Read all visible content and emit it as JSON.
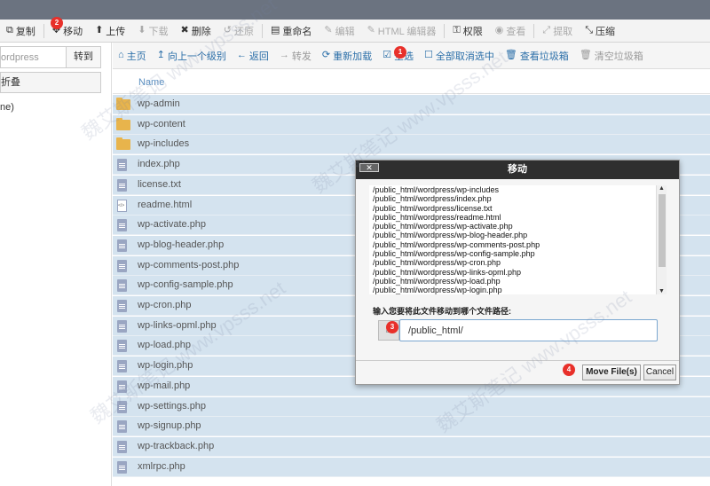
{
  "toolbar": {
    "items": [
      {
        "icon": "copy-icon",
        "glyph": "⧉",
        "label": "复制",
        "disabled": false
      },
      {
        "icon": "move-icon",
        "glyph": "✥",
        "label": "移动",
        "disabled": false
      },
      {
        "icon": "upload-icon",
        "glyph": "⬆",
        "label": "上传",
        "disabled": false
      },
      {
        "icon": "download-icon",
        "glyph": "⬇",
        "label": "下载",
        "disabled": true
      },
      {
        "icon": "delete-icon",
        "glyph": "✖",
        "label": "删除",
        "disabled": false
      },
      {
        "icon": "restore-icon",
        "glyph": "↺",
        "label": "还原",
        "disabled": true
      },
      {
        "icon": "rename-icon",
        "glyph": "▤",
        "label": "重命名",
        "disabled": false
      },
      {
        "icon": "edit-icon",
        "glyph": "✎",
        "label": "编辑",
        "disabled": true
      },
      {
        "icon": "html-editor-icon",
        "glyph": "✎",
        "label": "HTML 编辑器",
        "disabled": true
      },
      {
        "icon": "key-icon",
        "glyph": "⚿",
        "label": "权限",
        "disabled": false
      },
      {
        "icon": "eye-icon",
        "glyph": "◉",
        "label": "查看",
        "disabled": true
      },
      {
        "icon": "extract-icon",
        "glyph": "⤢",
        "label": "提取",
        "disabled": true
      },
      {
        "icon": "compress-icon",
        "glyph": "⤡",
        "label": "压缩",
        "disabled": false
      }
    ]
  },
  "sidebar": {
    "search_value": "ordpress",
    "go_label": "转到",
    "collapse_label": "折叠",
    "tree_item": "ne)"
  },
  "nav": {
    "items": [
      {
        "icon": "home-icon",
        "glyph": "⌂",
        "label": "主页",
        "disabled": false
      },
      {
        "icon": "level-up-icon",
        "glyph": "↥",
        "label": "向上一个级别",
        "disabled": false
      },
      {
        "icon": "back-icon",
        "glyph": "←",
        "label": "返回",
        "disabled": false
      },
      {
        "icon": "forward-icon",
        "glyph": "→",
        "label": "转发",
        "disabled": true
      },
      {
        "icon": "reload-icon",
        "glyph": "⟳",
        "label": "重新加载",
        "disabled": false
      },
      {
        "icon": "select-all-icon",
        "glyph": "☑",
        "label": "全选",
        "disabled": false
      },
      {
        "icon": "deselect-icon",
        "glyph": "☐",
        "label": "全部取消选中",
        "disabled": false
      },
      {
        "icon": "trash-icon",
        "glyph": "🗑",
        "label": "查看垃圾箱",
        "disabled": false
      },
      {
        "icon": "empty-trash-icon",
        "glyph": "🗑",
        "label": "清空垃圾箱",
        "disabled": true
      }
    ]
  },
  "file_header": {
    "name_label": "Name"
  },
  "files": [
    {
      "name": "wp-admin",
      "type": "folder"
    },
    {
      "name": "wp-content",
      "type": "folder"
    },
    {
      "name": "wp-includes",
      "type": "folder"
    },
    {
      "name": "index.php",
      "type": "doc"
    },
    {
      "name": "license.txt",
      "type": "doc"
    },
    {
      "name": "readme.html",
      "type": "html"
    },
    {
      "name": "wp-activate.php",
      "type": "doc"
    },
    {
      "name": "wp-blog-header.php",
      "type": "doc"
    },
    {
      "name": "wp-comments-post.php",
      "type": "doc"
    },
    {
      "name": "wp-config-sample.php",
      "type": "doc"
    },
    {
      "name": "wp-cron.php",
      "type": "doc"
    },
    {
      "name": "wp-links-opml.php",
      "type": "doc"
    },
    {
      "name": "wp-load.php",
      "type": "doc"
    },
    {
      "name": "wp-login.php",
      "type": "doc"
    },
    {
      "name": "wp-mail.php",
      "type": "doc"
    },
    {
      "name": "wp-settings.php",
      "type": "doc"
    },
    {
      "name": "wp-signup.php",
      "type": "doc"
    },
    {
      "name": "wp-trackback.php",
      "type": "doc"
    },
    {
      "name": "xmlrpc.php",
      "type": "doc"
    }
  ],
  "dialog": {
    "title": "移动",
    "close_label": "✕",
    "list": [
      "/public_html/wordpress/wp-includes",
      "/public_html/wordpress/index.php",
      "/public_html/wordpress/license.txt",
      "/public_html/wordpress/readme.html",
      "/public_html/wordpress/wp-activate.php",
      "/public_html/wordpress/wp-blog-header.php",
      "/public_html/wordpress/wp-comments-post.php",
      "/public_html/wordpress/wp-config-sample.php",
      "/public_html/wordpress/wp-cron.php",
      "/public_html/wordpress/wp-links-opml.php",
      "/public_html/wordpress/wp-load.php",
      "/public_html/wordpress/wp-login.php"
    ],
    "prompt": "输入您要将此文件移动到哪个文件路径:",
    "home_glyph": "⌂",
    "path_value": "/public_html/",
    "move_label": "Move File(s)",
    "cancel_label": "Cancel"
  },
  "badges": [
    "1",
    "2",
    "3",
    "4"
  ],
  "watermark": "魏艾斯笔记 www.vpsss.net"
}
